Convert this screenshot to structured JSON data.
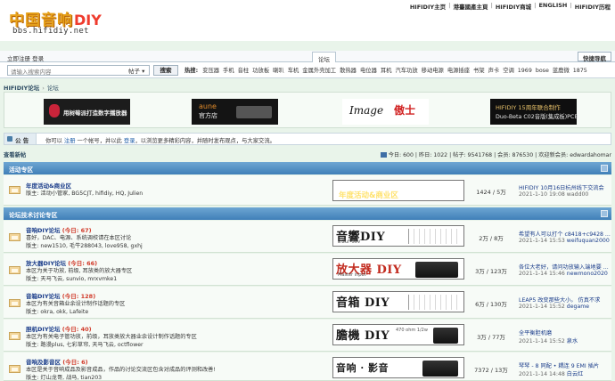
{
  "logo": {
    "cn": "中国音响",
    "diy": "DIY",
    "url": "bbs.hifidiy.net"
  },
  "topnav": [
    "HIFIDIY主页",
    "港臺國產主頁",
    "HIFIDIY商城",
    "ENGLISH",
    "HIFIDIY历程"
  ],
  "login": {
    "text1": "立即注册",
    "text2": "登录",
    "forum_tab": "论坛",
    "quick_nav": "快捷导航"
  },
  "search": {
    "placeholder": "请输入搜索内容",
    "type": "帖子",
    "button": "搜索",
    "hot_label": "热搜:",
    "hot": [
      "变压器",
      "手机",
      "音柱",
      "功放板",
      "喇叭",
      "车机",
      "金属外壳加工",
      "散热器",
      "电位器",
      "耳机",
      "汽车功放",
      "移动电源",
      "电源插座",
      "书架",
      "声卡",
      "空调",
      "1969",
      "bose",
      "蓝鹿微",
      "1875"
    ]
  },
  "breadcrumb": {
    "home": "HIFIDIY论坛",
    "sep": "›",
    "current": "论坛"
  },
  "banners": [
    {
      "text": "用树莓派打造数字播放器"
    },
    {
      "line1": "aune",
      "line2": "官方店"
    },
    {
      "line1": "Image",
      "line2": "傲士"
    },
    {
      "line1": "HIFIDIY 15周年联合制作",
      "line2": "Duo-Beta C02音版(集成板)PCB"
    }
  ],
  "notice": {
    "label": "公 告",
    "text_a": "你可以 ",
    "link_a": "注册",
    "text_b": " 一个帐号，并以此 ",
    "link_b": "登录",
    "text_c": "，以浏览更多精彩内容，并随时发布观点，与大家交流。"
  },
  "stats": {
    "new_posts": "查看新帖",
    "text": "今日: 600 | 昨日: 1022 | 帖子: 9541768 | 会员: 876530 | 欢迎新会员: edwardahomar"
  },
  "categories": [
    {
      "title": "活动专区",
      "forums": [
        {
          "name": "年度活动&商业区",
          "today": "",
          "desc": "",
          "mods": "版主: 活动小管家, BG5CJT, hifidiy, HQ, Julien",
          "image": {
            "kind": "gold",
            "l1": "HIFIDIY",
            "l2": "年度活动&商业区"
          },
          "count": "1424 / 5万",
          "last_title": "HIFIDIY 10月16日杭州线下交流会",
          "last_meta": "2021-1-10 19:08 wadd00"
        }
      ]
    },
    {
      "title": "论坛技术讨论专区",
      "forums": [
        {
          "name": "音响DIY论坛",
          "today": " (今日: 67)",
          "desc": "喜好，DAC、电源、系统调校请在本区讨论",
          "mods": "版主: new1510, 毛牛288043, love958, gxhj",
          "image": {
            "kind": "diy",
            "l1": "音響DIY",
            "sub": "2.2uF 50V"
          },
          "count": "2万 / 8万",
          "last_title": "希望有人可以打个 c8418+c9428 ...",
          "last_time": "2021-1-14 15:53 ",
          "last_user": "weifuquan2000"
        },
        {
          "name": "放大器DIY论坛",
          "today": " (今日: 66)",
          "desc": "本区为关于功放, 前级, 耳放类的放大器专区",
          "mods": "版主: 天马飞云, sunvio, mrxvmke1",
          "image": {
            "kind": "diy-red",
            "l1": "放大器 DIY",
            "sub": "Master  input"
          },
          "count": "3万 / 123万",
          "last_title": "各位大老好，请问功放输入端地要 ...",
          "last_time": "2021-1-14 15:46 ",
          "last_user": "newmono2020"
        },
        {
          "name": "音箱DIY论坛",
          "today": " (今日: 128)",
          "desc": "本区为有关音箱业余设计制作话题的专区",
          "mods": "版主: okra, okk, Lafeite",
          "image": {
            "kind": "diy",
            "l1": "音箱 DIY",
            "sub": ""
          },
          "count": "6万 / 130万",
          "last_title": "LEAP5 改变那些大小。 仿真不求",
          "last_time": "2021-1-14 15:52 ",
          "last_user": "degame"
        },
        {
          "name": "胆机DIY论坛",
          "today": " (今日: 40)",
          "desc": "本区为有关电子管功放，前级，耳放类放大器业余设计制作话题的专区",
          "mods": "版主: 路漫plus, 七彩草帘, 天马飞云, octflower",
          "image": {
            "kind": "diy",
            "l1": "膽機 DIY",
            "sub": "470 ohm 1/2w"
          },
          "count": "3万 / 77万",
          "last_title": "全平衡胆机磨",
          "last_time": "2021-1-14 15:52 ",
          "last_user": "泉水"
        },
        {
          "name": "音响及影音区",
          "today": " (今日: 6)",
          "desc": "本区是关于音响成品及影音成品，作品的讨论交流区包含对成品的评测和改善!",
          "mods": "版主: 灯山龙哥, 战马, tian203",
          "image": {
            "kind": "av",
            "l1": "音响 · 影音",
            "sub": ""
          },
          "count": "7372 / 13万",
          "last_title": "琴琴 - 8 同配 • 耦连 9 EMI 插片",
          "last_time": "2021-1-14 14:48 ",
          "last_user": "白云红"
        }
      ]
    }
  ]
}
